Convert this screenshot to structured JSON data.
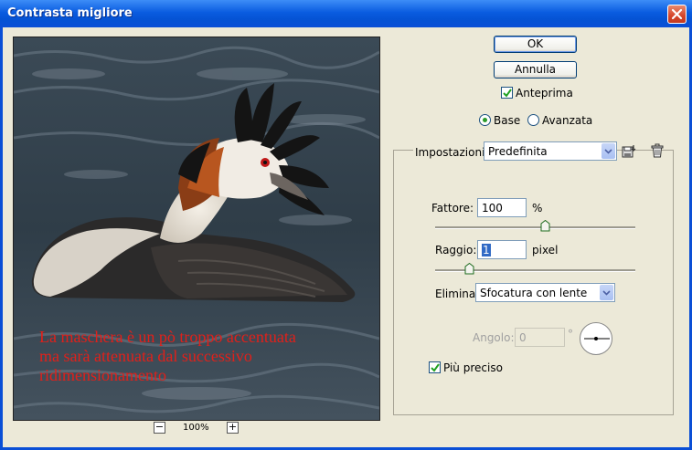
{
  "window": {
    "title": "Contrasta migliore"
  },
  "preview": {
    "overlay_line1": "La maschera è un pò troppo accentuata",
    "overlay_line2": "ma sarà attenuata dal successivo",
    "overlay_line3": "ridimensionamento",
    "zoom_out": "−",
    "zoom_in": "+",
    "zoom_level": "100%"
  },
  "buttons": {
    "ok": "OK",
    "cancel": "Annulla"
  },
  "preview_option": {
    "label": "Anteprima",
    "checked": true
  },
  "mode": {
    "basic": "Base",
    "advanced": "Avanzata",
    "selected": "basic"
  },
  "settings": {
    "label": "Impostazioni:",
    "value": "Predefinita"
  },
  "amount": {
    "label": "Fattore:",
    "value": "100",
    "unit": "%",
    "slider_fraction": 0.55
  },
  "radius": {
    "label": "Raggio:",
    "value": "1",
    "unit": "pixel",
    "slider_fraction": 0.17
  },
  "remove": {
    "label": "Elimina:",
    "value": "Sfocatura con lente"
  },
  "angle": {
    "label": "Angolo:",
    "value": "0",
    "unit": "°"
  },
  "more_accurate": {
    "label": "Più preciso",
    "checked": true
  },
  "icons": {
    "close": "close-icon",
    "save": "save-settings-icon",
    "delete": "trash-icon",
    "check": "check-icon"
  }
}
